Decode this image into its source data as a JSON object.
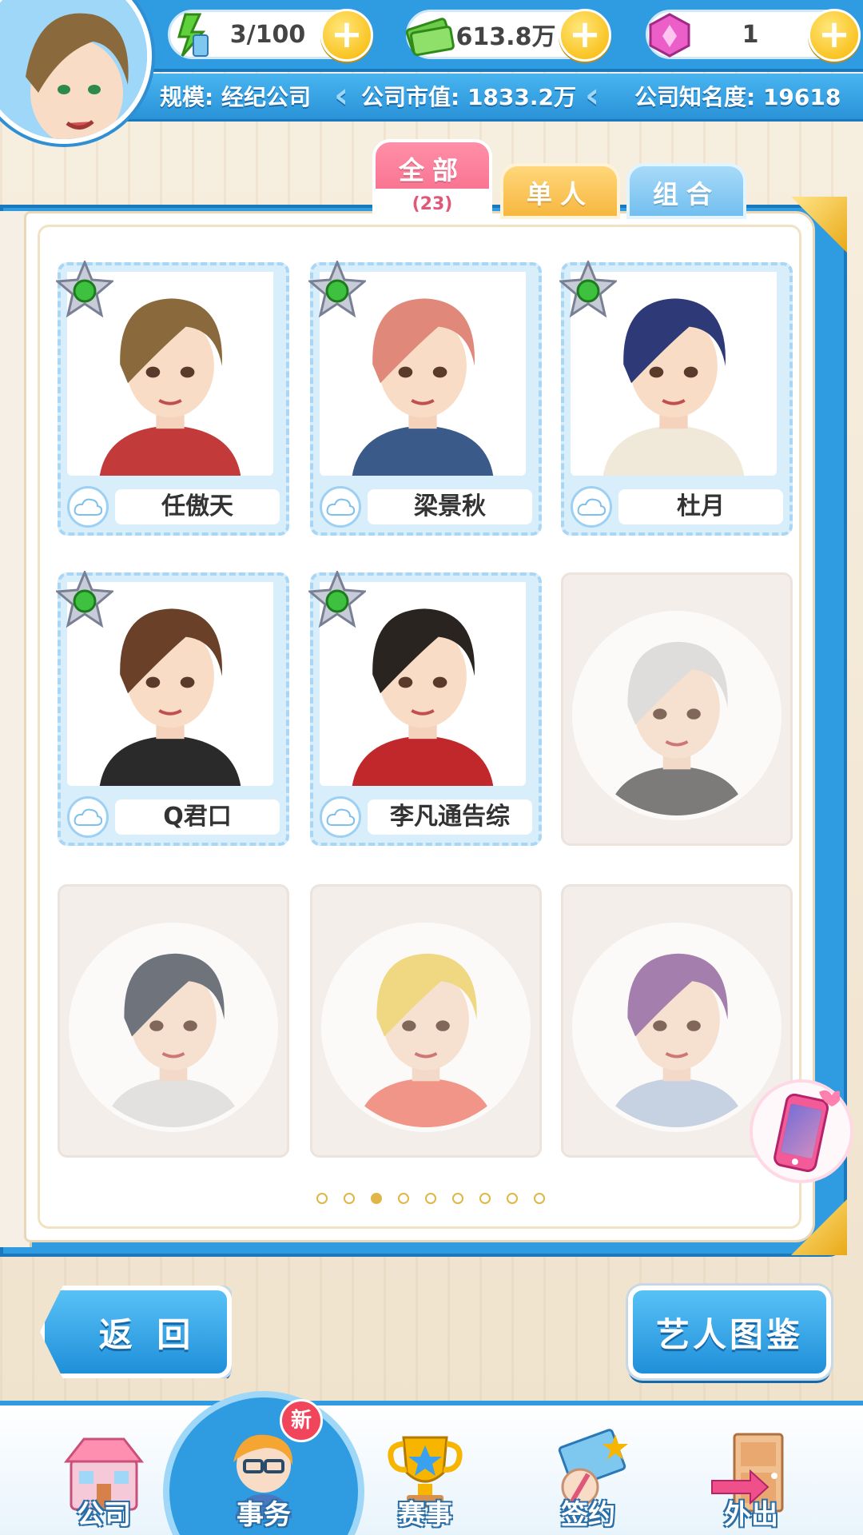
{
  "resources": {
    "energy": "3/100",
    "money": "613.8万",
    "gems": "1",
    "plus_symbol": "+"
  },
  "company": {
    "scale": "规模: 经纪公司",
    "market_value": "公司市值: 1833.2万",
    "fame": "公司知名度: 19618"
  },
  "tabs": {
    "all_label": "全部",
    "all_count": "(23)",
    "solo_label": "单人",
    "group_label": "组合"
  },
  "artists": [
    {
      "name": "任傲天",
      "hair": "#8a6a3c",
      "shirt": "#c23a3a"
    },
    {
      "name": "梁景秋",
      "hair": "#e0887a",
      "shirt": "#3a5a8a"
    },
    {
      "name": "杜月",
      "hair": "#2e3a78",
      "shirt": "#f0e8d8"
    },
    {
      "name": "Q君口",
      "hair": "#6a4028",
      "shirt": "#2a2a2a"
    },
    {
      "name": "李凡通告综",
      "hair": "#2a2420",
      "shirt": "#c0282c"
    }
  ],
  "locked_cards": [
    {
      "hair": "#d8d8d8",
      "shirt": "#555"
    },
    {
      "hair": "#444a58",
      "shirt": "#ddd"
    },
    {
      "hair": "#f0d060",
      "shirt": "#f07868"
    },
    {
      "hair": "#8a5a9a",
      "shirt": "#b8c8e0"
    }
  ],
  "pagination": {
    "total": 9,
    "active": 3
  },
  "buttons": {
    "back": "返 回",
    "gallery": "艺人图鉴"
  },
  "bottom_nav": {
    "company": "公司",
    "affairs": "事务",
    "events": "赛事",
    "sign": "签约",
    "outing": "外出",
    "new_badge": "新"
  },
  "colors": {
    "primary_blue": "#2f9be0",
    "tab_all_pink": "#f56484",
    "tab_solo_yellow": "#f7b740",
    "tab_group_blue": "#72bff0",
    "status_green": "#3ec13e",
    "gold": "#f7b500"
  }
}
